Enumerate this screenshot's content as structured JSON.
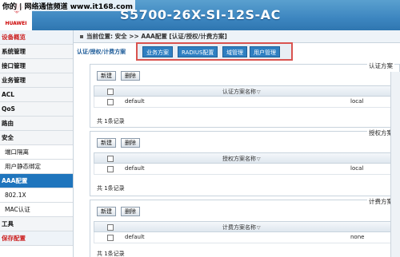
{
  "header": {
    "watermark": "你的 | 网络通信频道 www.it168.com",
    "device_title": "S5700-26X-SI-12S-AC",
    "logo_text": "HUAWEI"
  },
  "breadcrumb": {
    "text": "当前位置: 安全 >>  AAA配置 [认证/授权/计费方案]"
  },
  "sidebar": {
    "items": [
      {
        "label": "设备概览",
        "kind": "top"
      },
      {
        "label": "系统管理",
        "kind": "section"
      },
      {
        "label": "接口管理",
        "kind": "section"
      },
      {
        "label": "业务管理",
        "kind": "section"
      },
      {
        "label": "ACL",
        "kind": "section"
      },
      {
        "label": "QoS",
        "kind": "section"
      },
      {
        "label": "路由",
        "kind": "section"
      },
      {
        "label": "安全",
        "kind": "section"
      },
      {
        "label": "端口隔离",
        "kind": "sub"
      },
      {
        "label": "用户静态绑定",
        "kind": "sub"
      },
      {
        "label": "AAA配置",
        "kind": "active"
      },
      {
        "label": "802.1X",
        "kind": "sub"
      },
      {
        "label": "MAC认证",
        "kind": "sub"
      },
      {
        "label": "工具",
        "kind": "section"
      },
      {
        "label": "保存配置",
        "kind": "save"
      }
    ]
  },
  "tabs": {
    "current": "认证/授权/计费方案",
    "items": [
      "业务方案",
      "RADIUS配置",
      "域管理",
      "用户管理"
    ]
  },
  "panels": [
    {
      "title": "认证方案",
      "new_label": "新建",
      "delete_label": "删除",
      "column": "认证方案名称",
      "rows": [
        {
          "name": "default",
          "value": "local"
        }
      ],
      "count": "共 1条记录"
    },
    {
      "title": "授权方案",
      "new_label": "新建",
      "delete_label": "删除",
      "column": "授权方案名称",
      "rows": [
        {
          "name": "default",
          "value": "local"
        }
      ],
      "count": "共 1条记录"
    },
    {
      "title": "计费方案",
      "new_label": "新建",
      "delete_label": "删除",
      "column": "计费方案名称",
      "rows": [
        {
          "name": "default",
          "value": "none"
        }
      ],
      "count": "共 1条记录"
    }
  ],
  "colors": {
    "header_blue": "#3d86c0",
    "active_blue": "#1f75bd",
    "highlight_red": "#d9534f"
  }
}
